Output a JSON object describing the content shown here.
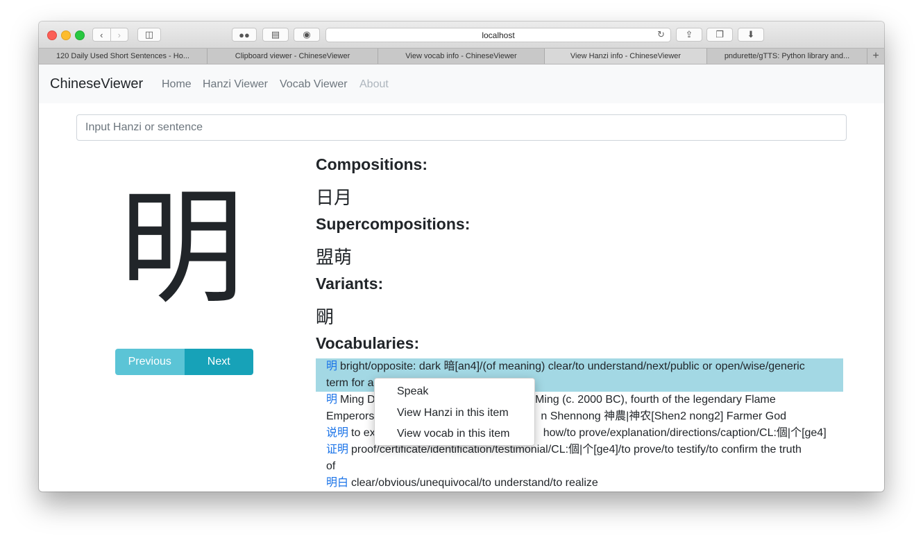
{
  "browser": {
    "url": "localhost",
    "tabs": [
      {
        "label": "120 Daily Used Short Sentences - Ho...",
        "active": false
      },
      {
        "label": "Clipboard viewer - ChineseViewer",
        "active": false
      },
      {
        "label": "View vocab info - ChineseViewer",
        "active": false
      },
      {
        "label": "View Hanzi info - ChineseViewer",
        "active": true
      },
      {
        "label": "pndurette/gTTS: Python library and...",
        "active": false
      }
    ],
    "new_tab": "+"
  },
  "navbar": {
    "brand": "ChineseViewer",
    "links": [
      "Home",
      "Hanzi Viewer",
      "Vocab Viewer",
      "About"
    ]
  },
  "search": {
    "placeholder": "Input Hanzi or sentence"
  },
  "hanzi": "明",
  "buttons": {
    "previous": "Previous",
    "next": "Next"
  },
  "sections": {
    "compositions_title": "Compositions:",
    "compositions": "日月",
    "supercompositions_title": "Supercompositions:",
    "supercompositions": "盟萌",
    "variants_title": "Variants:",
    "variants": "朙",
    "vocabularies_title": "Vocabularies:"
  },
  "vocabularies": [
    {
      "word": "明",
      "lines": [
        "bright/opposite: dark 暗[an4]/(of meaning) clear/to understand/next/public or open/wise/generic",
        "term for a"
      ]
    },
    {
      "word": "明",
      "lines": [
        "Ming D",
        "ng/Ming (c. 2000 BC), fourth of the legendary Flame",
        "Emperors",
        "n Shennong 神農|神农[Shen2 nong2] Farmer God"
      ]
    },
    {
      "word": "说明",
      "lines": [
        "to ex",
        "how/to prove/explanation/directions/caption/CL:個|个[ge4]"
      ]
    },
    {
      "word": "证明",
      "lines": [
        "proof/certificate/identification/testimonial/CL:個|个[ge4]/to prove/to testify/to confirm the truth",
        "of"
      ]
    },
    {
      "word": "明白",
      "lines": [
        "clear/obvious/unequivocal/to understand/to realize"
      ]
    }
  ],
  "context_menu": [
    "Speak",
    "View Hanzi in this item",
    "View vocab in this item"
  ]
}
